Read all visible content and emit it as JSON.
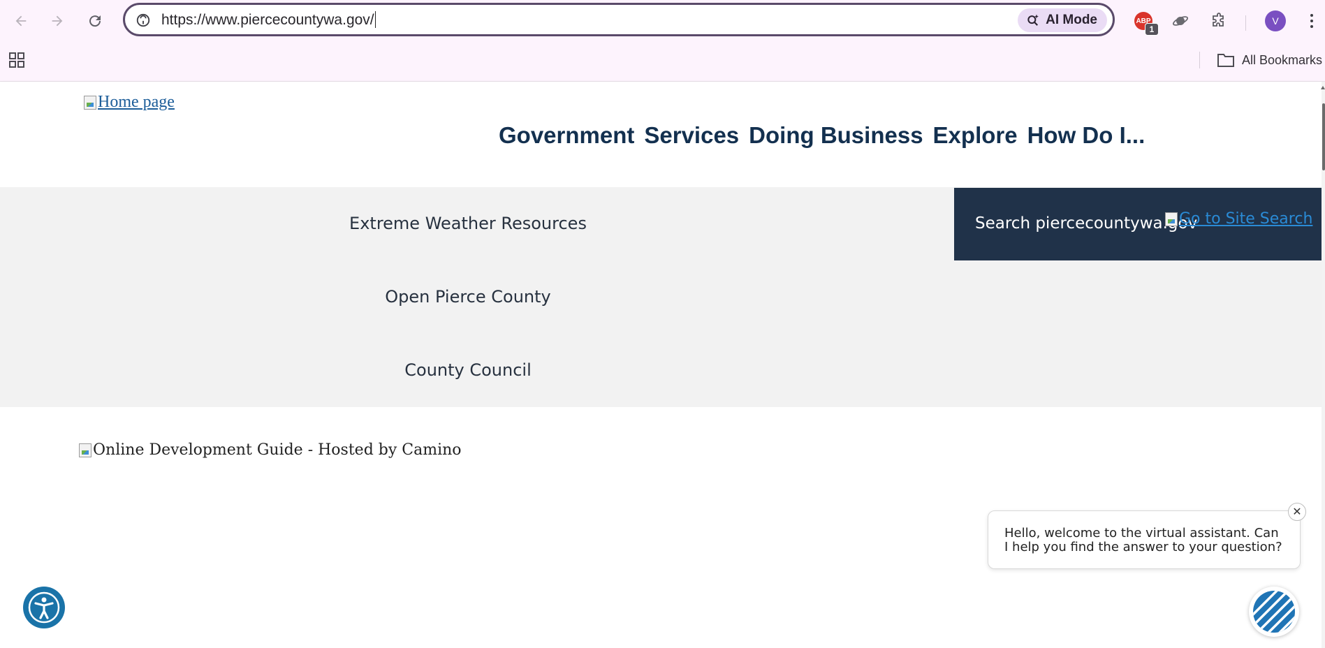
{
  "browser": {
    "url": "https://www.piercecountywa.gov/",
    "ai_mode_label": "AI Mode",
    "adblock_label": "ABP",
    "adblock_badge": "1",
    "profile_initial": "V",
    "bookmarks_label": "All Bookmarks"
  },
  "header": {
    "home_link": "Home page",
    "nav": [
      "Government",
      "Services",
      "Doing Business",
      "Explore",
      "How Do I..."
    ]
  },
  "quick_links": [
    "Extreme Weather Resources",
    "Open Pierce County",
    "County Council"
  ],
  "search": {
    "label": "Search piercecountywa.gov",
    "button_alt": "Go to Site Search"
  },
  "dev_guide_alt": "Online Development Guide - Hosted by Camino",
  "chat": {
    "message": "Hello, welcome to the virtual assistant. Can I help you find the answer to your question?",
    "close_glyph": "✕"
  },
  "colors": {
    "chrome_bg": "#fdf3fd",
    "nav_text": "#13304f",
    "search_bg": "#203249",
    "link_blue": "#1c5d99",
    "alerts_bg": "#f2f2f2"
  }
}
